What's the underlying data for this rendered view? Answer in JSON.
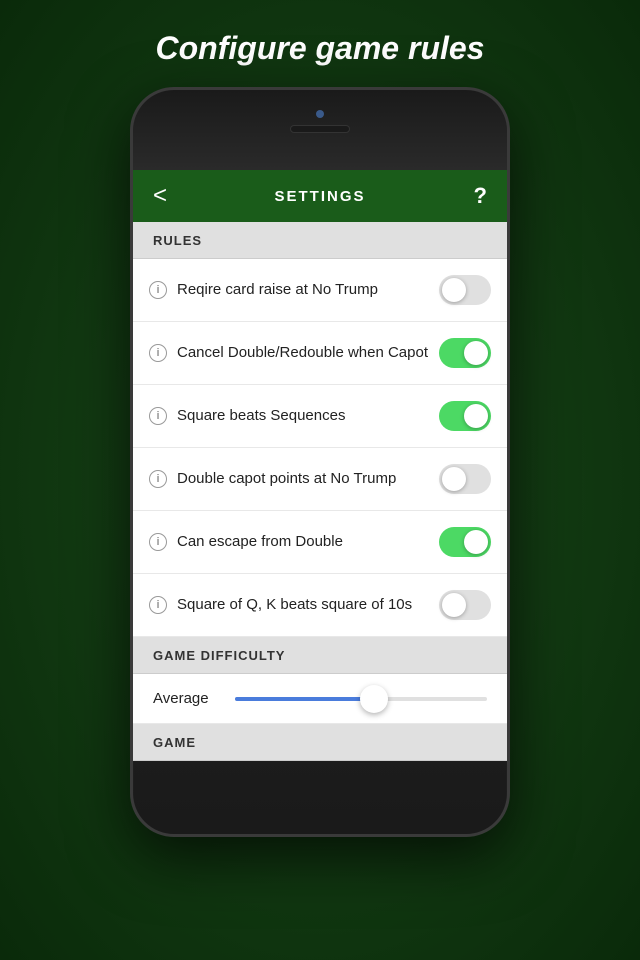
{
  "page": {
    "title": "Configure game rules"
  },
  "header": {
    "back_label": "<",
    "title": "SETTINGS",
    "help_label": "?"
  },
  "sections": [
    {
      "id": "rules",
      "header": "RULES",
      "items": [
        {
          "id": "require-card-raise",
          "label": "Reqire card raise at No Trump",
          "toggle": "off"
        },
        {
          "id": "cancel-double",
          "label": "Cancel Double/Redouble when Capot",
          "toggle": "on"
        },
        {
          "id": "square-beats",
          "label": "Square beats Sequences",
          "toggle": "on"
        },
        {
          "id": "double-capot",
          "label": "Double capot points at No Trump",
          "toggle": "off"
        },
        {
          "id": "can-escape",
          "label": "Can escape from Double",
          "toggle": "on"
        },
        {
          "id": "square-qk",
          "label": "Square of Q, K beats square of 10s",
          "toggle": "off"
        }
      ]
    },
    {
      "id": "game-difficulty",
      "header": "GAME DIFFICULTY",
      "items": []
    },
    {
      "id": "game",
      "header": "GAME",
      "items": []
    }
  ],
  "difficulty": {
    "label": "Average",
    "fill_percent": 55
  }
}
